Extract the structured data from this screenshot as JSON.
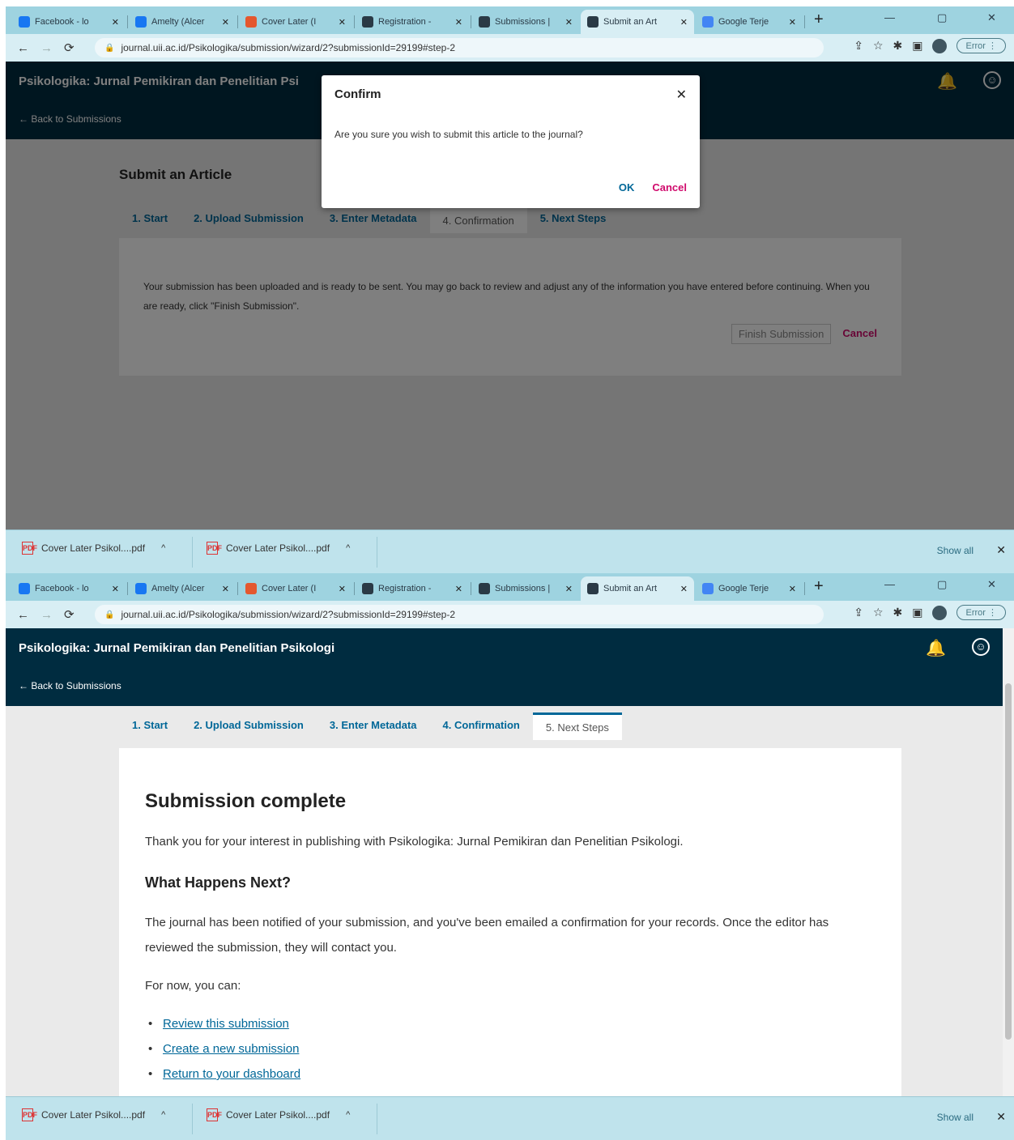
{
  "browser": {
    "tabs": [
      {
        "label": "Facebook - lo",
        "favicon_color": "#1877f2"
      },
      {
        "label": "Amelty (Alcer",
        "favicon_color": "#1877f2"
      },
      {
        "label": "Cover Later (I",
        "favicon_color": "#e4572e"
      },
      {
        "label": "Registration -",
        "favicon_color": "#2a3a46"
      },
      {
        "label": "Submissions |",
        "favicon_color": "#2a3a46"
      },
      {
        "label": "Submit an Art",
        "favicon_color": "#2a3a46"
      },
      {
        "label": "Google Terje",
        "favicon_color": "#4285f4"
      }
    ],
    "tab_close": "✕",
    "new_tab": "+",
    "window_controls": {
      "minimize": "—",
      "maximize": "▢",
      "close": "✕"
    },
    "nav": {
      "back": "←",
      "forward": "→",
      "reload": "⟳"
    },
    "url": "journal.uii.ac.id/Psikologika/submission/wizard/2?submissionId=29199#step-2",
    "error_label": "Error",
    "address_icons": {
      "share": "⇪",
      "star": "☆",
      "extension": "✱",
      "sidepanel": "▣",
      "menu": "⋮"
    }
  },
  "app": {
    "site_title_truncated": "Psikologika: Jurnal Pemikiran dan Penelitian Psi",
    "site_title": "Psikologika: Jurnal Pemikiran dan Penelitian Psikologi",
    "back_link": "← Back to Submissions",
    "bell_icon": "🔔",
    "user_icon": "☺"
  },
  "top": {
    "pane_title": "Submit an Article",
    "steps": [
      "1. Start",
      "2. Upload Submission",
      "3. Enter Metadata",
      "4. Confirmation",
      "5. Next Steps"
    ],
    "confirm_text": "Your submission has been uploaded and is ready to be sent. You may go back to review and adjust any of the information you have entered before continuing. When you are ready, click \"Finish Submission\".",
    "finish_button": "Finish Submission",
    "cancel_button": "Cancel",
    "modal": {
      "title": "Confirm",
      "close": "✕",
      "message": "Are you sure you wish to submit this article to the journal?",
      "ok": "OK",
      "cancel": "Cancel"
    }
  },
  "bottom": {
    "steps": [
      "1. Start",
      "2. Upload Submission",
      "3. Enter Metadata",
      "4. Confirmation",
      "5. Next Steps"
    ],
    "heading": "Submission complete",
    "thanks": "Thank you for your interest in publishing with Psikologika: Jurnal Pemikiran dan Penelitian Psikologi.",
    "subheading": "What Happens Next?",
    "next_text": "The journal has been notified of your submission, and you've been emailed a confirmation for your records. Once the editor has reviewed the submission, they will contact you.",
    "for_now": "For now, you can:",
    "links": [
      "Review this submission",
      "Create a new submission",
      "Return to your dashboard"
    ]
  },
  "downloads": {
    "items": [
      {
        "name": "Cover Later Psikol....pdf"
      },
      {
        "name": "Cover Later Psikol....pdf"
      }
    ],
    "pdf_icon": "PDF",
    "caret": "^",
    "show_all": "Show all",
    "close": "✕"
  }
}
